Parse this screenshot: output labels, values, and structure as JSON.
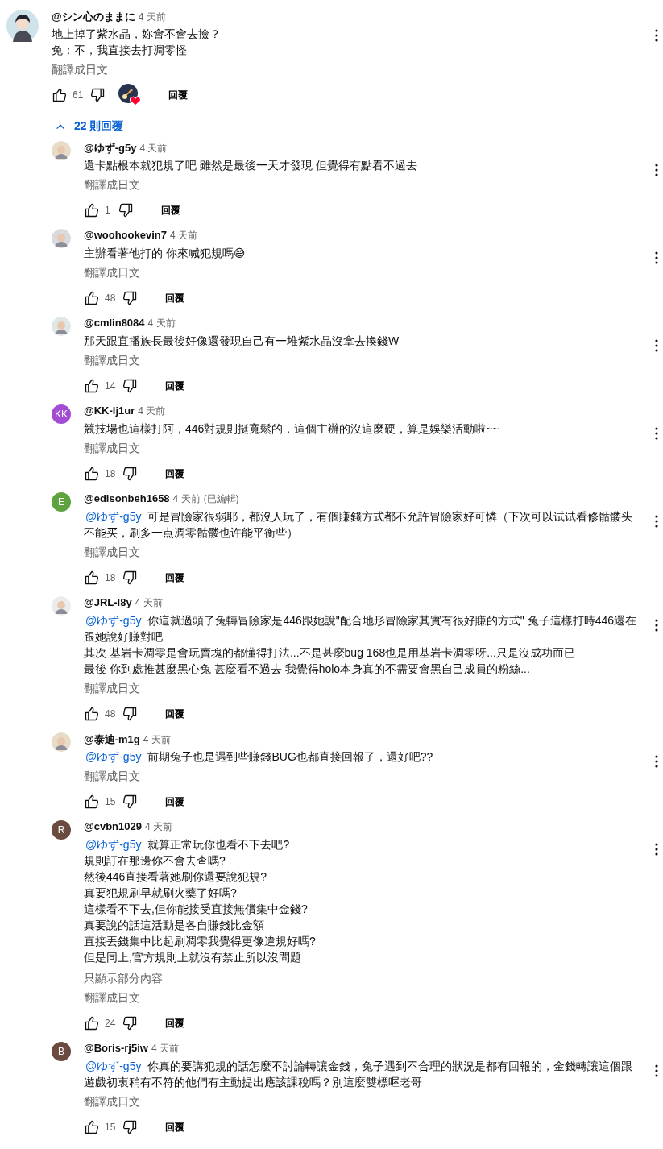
{
  "comment": {
    "author": "@シン心のままに",
    "time": "4 天前",
    "lines": [
      "地上掉了紫水晶，妳會不會去撿？",
      "兔：不，我直接去打凋零怪"
    ],
    "translate": "翻譯成日文",
    "likes": "61",
    "hearted": true,
    "reply": "回覆"
  },
  "replies_toggle": {
    "expanded": true,
    "label": "22 則回覆"
  },
  "replies": [
    {
      "avatar": {
        "kind": "picture"
      },
      "author": "@ゆず-g5y",
      "time": "4 天前",
      "lines": [
        "還卡點根本就犯規了吧 雖然是最後一天才發現 但覺得有點看不過去"
      ],
      "translate": "翻譯成日文",
      "likes": "1",
      "reply": "回覆"
    },
    {
      "avatar": {
        "kind": "picture"
      },
      "author": "@woohookevin7",
      "time": "4 天前",
      "lines": [
        "主辦看著他打的 你來喊犯規嗎😅"
      ],
      "translate": "翻譯成日文",
      "likes": "48",
      "reply": "回覆"
    },
    {
      "avatar": {
        "kind": "picture"
      },
      "author": "@cmlin8084",
      "time": "4 天前",
      "lines": [
        "那天跟直播族長最後好像還發現自己有一堆紫水晶沒拿去換錢W"
      ],
      "translate": "翻譯成日文",
      "likes": "14",
      "reply": "回覆"
    },
    {
      "avatar": {
        "kind": "letter",
        "letter": "KK",
        "color": "#a34bd3"
      },
      "author": "@KK-lj1ur",
      "time": "4 天前",
      "lines": [
        "競技場也這樣打阿，446對規則挺寬鬆的，這個主辦的沒這麼硬，算是娛樂活動啦~~"
      ],
      "translate": "翻譯成日文",
      "likes": "18",
      "reply": "回覆"
    },
    {
      "avatar": {
        "kind": "letter",
        "letter": "E",
        "color": "#5ea33e"
      },
      "author": "@edisonbeh1658",
      "time": "4 天前",
      "edited": "(已編輯)",
      "mention": "@ゆず-g5y",
      "lines": [
        "可是冒險家很弱耶，都沒人玩了，有個賺錢方式都不允許冒險家好可憐（下次可以试试看修骷髅头不能买，刷多一点凋零骷髅也许能平衡些）"
      ],
      "translate": "翻譯成日文",
      "likes": "18",
      "reply": "回覆"
    },
    {
      "avatar": {
        "kind": "picture"
      },
      "author": "@JRL-l8y",
      "time": "4 天前",
      "mention": "@ゆず-g5y",
      "lines": [
        "你這就過頭了兔轉冒險家是446跟她說\"配合地形冒險家其實有很好賺的方式\" 兔子這樣打時446還在跟她說好賺對吧",
        "其次 基岩卡凋零是會玩賣塊的都懂得打法...不是甚麼bug 168也是用基岩卡凋零呀...只是沒成功而已",
        "最後 你到處推甚麼黑心兔 甚麼看不過去 我覺得holo本身真的不需要會黑自己成員的粉絲..."
      ],
      "translate": "翻譯成日文",
      "likes": "48",
      "reply": "回覆"
    },
    {
      "avatar": {
        "kind": "picture"
      },
      "author": "@泰迪-m1g",
      "time": "4 天前",
      "mention": "@ゆず-g5y",
      "lines": [
        "前期兔子也是遇到些賺錢BUG也都直接回報了，還好吧??"
      ],
      "translate": "翻譯成日文",
      "likes": "15",
      "reply": "回覆"
    },
    {
      "avatar": {
        "kind": "letter",
        "letter": "R",
        "color": "#6b4a40"
      },
      "author": "@cvbn1029",
      "time": "4 天前",
      "mention": "@ゆず-g5y",
      "lines": [
        "就算正常玩你也看不下去吧?",
        "規則訂在那邊你不會去查嗎?",
        "然後446直接看著她刷你還要說犯規?",
        "真要犯規刷早就刷火藥了好嗎?",
        "這樣看不下去,但你能接受直接無償集中金錢?",
        "真要說的話這活動是各自賺錢比金額",
        "直接丟錢集中比起刷凋零我覺得更像違規好嗎?",
        "但是同上,官方規則上就沒有禁止所以沒問題"
      ],
      "show_less": "只顯示部分內容",
      "translate": "翻譯成日文",
      "likes": "24",
      "reply": "回覆"
    },
    {
      "avatar": {
        "kind": "letter",
        "letter": "B",
        "color": "#6b4a40"
      },
      "author": "@Boris-rj5iw",
      "time": "4 天前",
      "mention": "@ゆず-g5y",
      "lines": [
        "你真的要講犯規的話怎麼不討論轉讓金錢，兔子遇到不合理的狀況是都有回報的，金錢轉讓這個跟遊戲初衷稍有不符的他們有主動提出應該課稅嗎？別這麼雙標喔老哥"
      ],
      "translate": "翻譯成日文",
      "likes": "15",
      "reply": "回覆"
    }
  ]
}
